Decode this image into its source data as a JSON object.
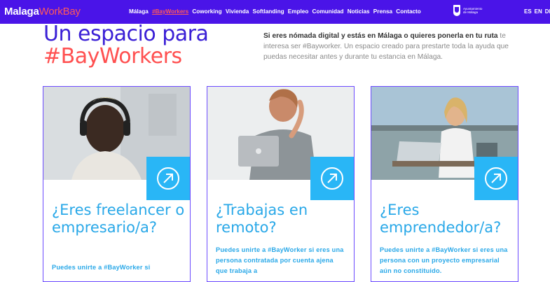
{
  "header": {
    "logo_part1": "Malaga",
    "logo_part2": "WorkBay",
    "nav": [
      "Málaga",
      "#BayWorkers",
      "Coworking",
      "Vivienda",
      "Softlanding",
      "Empleo",
      "Comunidad",
      "Noticias",
      "Prensa",
      "Contacto"
    ],
    "active_index": 1,
    "municipality_line1": "Ayuntamiento",
    "municipality_line2": "de Málaga",
    "languages": [
      "ES",
      "EN",
      "DE"
    ]
  },
  "hero": {
    "title_line1": "Un espacio para",
    "title_line2": "#BayWorkers",
    "intro_bold": "Si eres nómada digital y estás en Málaga o quieres ponerla en tu ruta",
    "intro_rest": " te interesa ser #Bayworker. Un espacio creado para prestarte toda la ayuda que puedas necesitar antes y durante tu estancia en Málaga."
  },
  "cards": [
    {
      "title": "¿Eres freelancer o empresario/a?",
      "desc": "Puedes unirte a #BayWorker si"
    },
    {
      "title": "¿Trabajas en remoto?",
      "desc": "Puedes unirte a #BayWorker si eres una persona contratada por cuenta ajena que trabaja a"
    },
    {
      "title": "¿Eres emprendedor/a?",
      "desc": "Puedes unirte a #BayWorker si eres una persona con un proyecto empresarial aún no constituido."
    }
  ],
  "colors": {
    "navbar": "#4a14e8",
    "accent_red": "#ff5050",
    "accent_blue": "#29b6f6",
    "title_purple": "#3a1fd6"
  },
  "icons": {
    "card_button": "arrow-up-right-icon"
  }
}
